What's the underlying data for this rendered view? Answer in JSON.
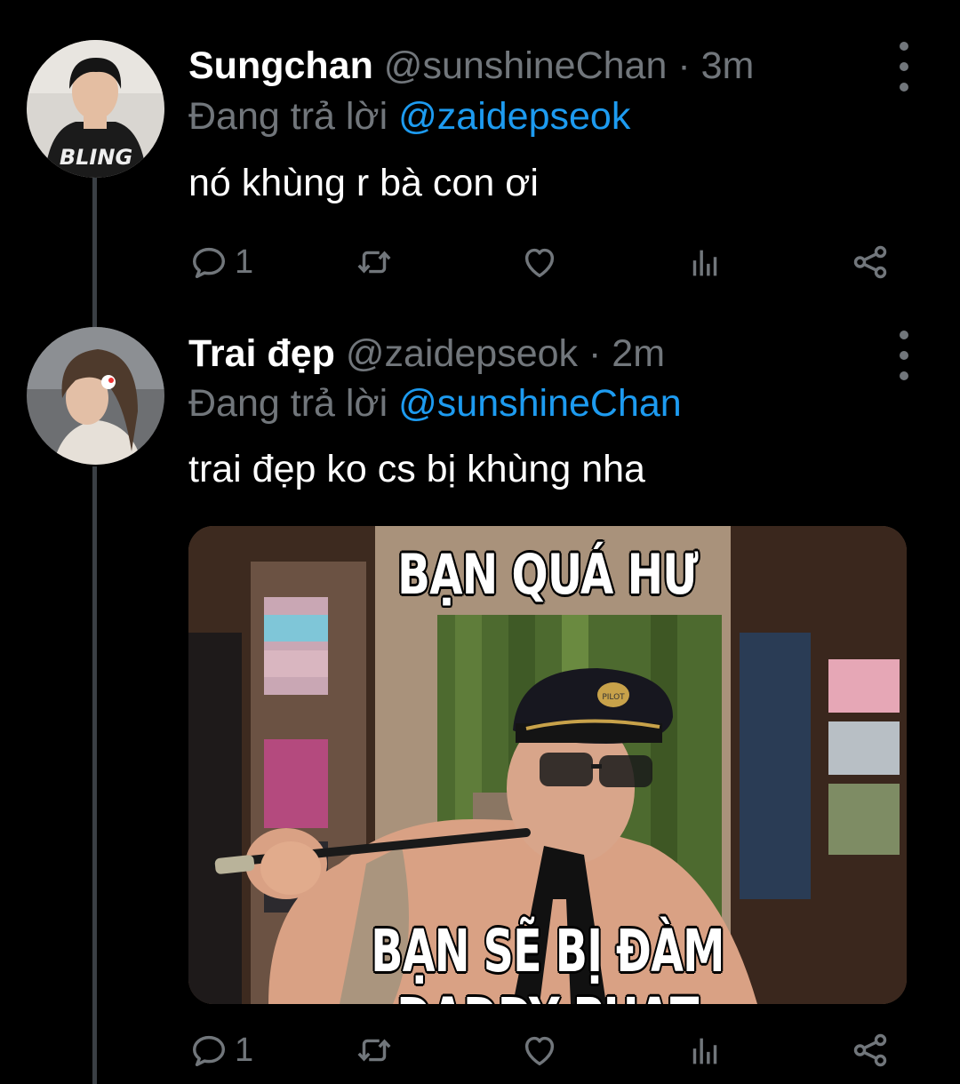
{
  "tweets": [
    {
      "display_name": "Sungchan",
      "handle": "@sunshineChan",
      "separator": "·",
      "time": "3m",
      "replying_prefix": "Đang trả lời",
      "replying_to": "@zaidepseok",
      "text": "nó khùng r bà con ơi",
      "reply_count": "1",
      "avatar_icon": "profile-photo",
      "avatar_text": "BLING"
    },
    {
      "display_name": "Trai đẹp",
      "handle": "@zaidepseok",
      "separator": "·",
      "time": "2m",
      "replying_prefix": "Đang trả lời",
      "replying_to": "@sunshineChan",
      "text": "trai đẹp ko cs bị khùng nha",
      "reply_count": "1",
      "avatar_icon": "profile-photo",
      "media": {
        "caption_top": "BẠN QUÁ HƯ",
        "caption_bottom": "BẠN SẼ BỊ ĐÀM DADDY PHẠT",
        "cap_text": "PILOT"
      }
    }
  ],
  "icons": {
    "reply": "reply-icon",
    "retweet": "retweet-icon",
    "like": "like-icon",
    "views": "views-icon",
    "share": "share-icon",
    "more": "more-icon"
  },
  "colors": {
    "background": "#000000",
    "text": "#ffffff",
    "muted": "#71767b",
    "link": "#1d9bf0",
    "thread_line": "#3a3f44"
  }
}
